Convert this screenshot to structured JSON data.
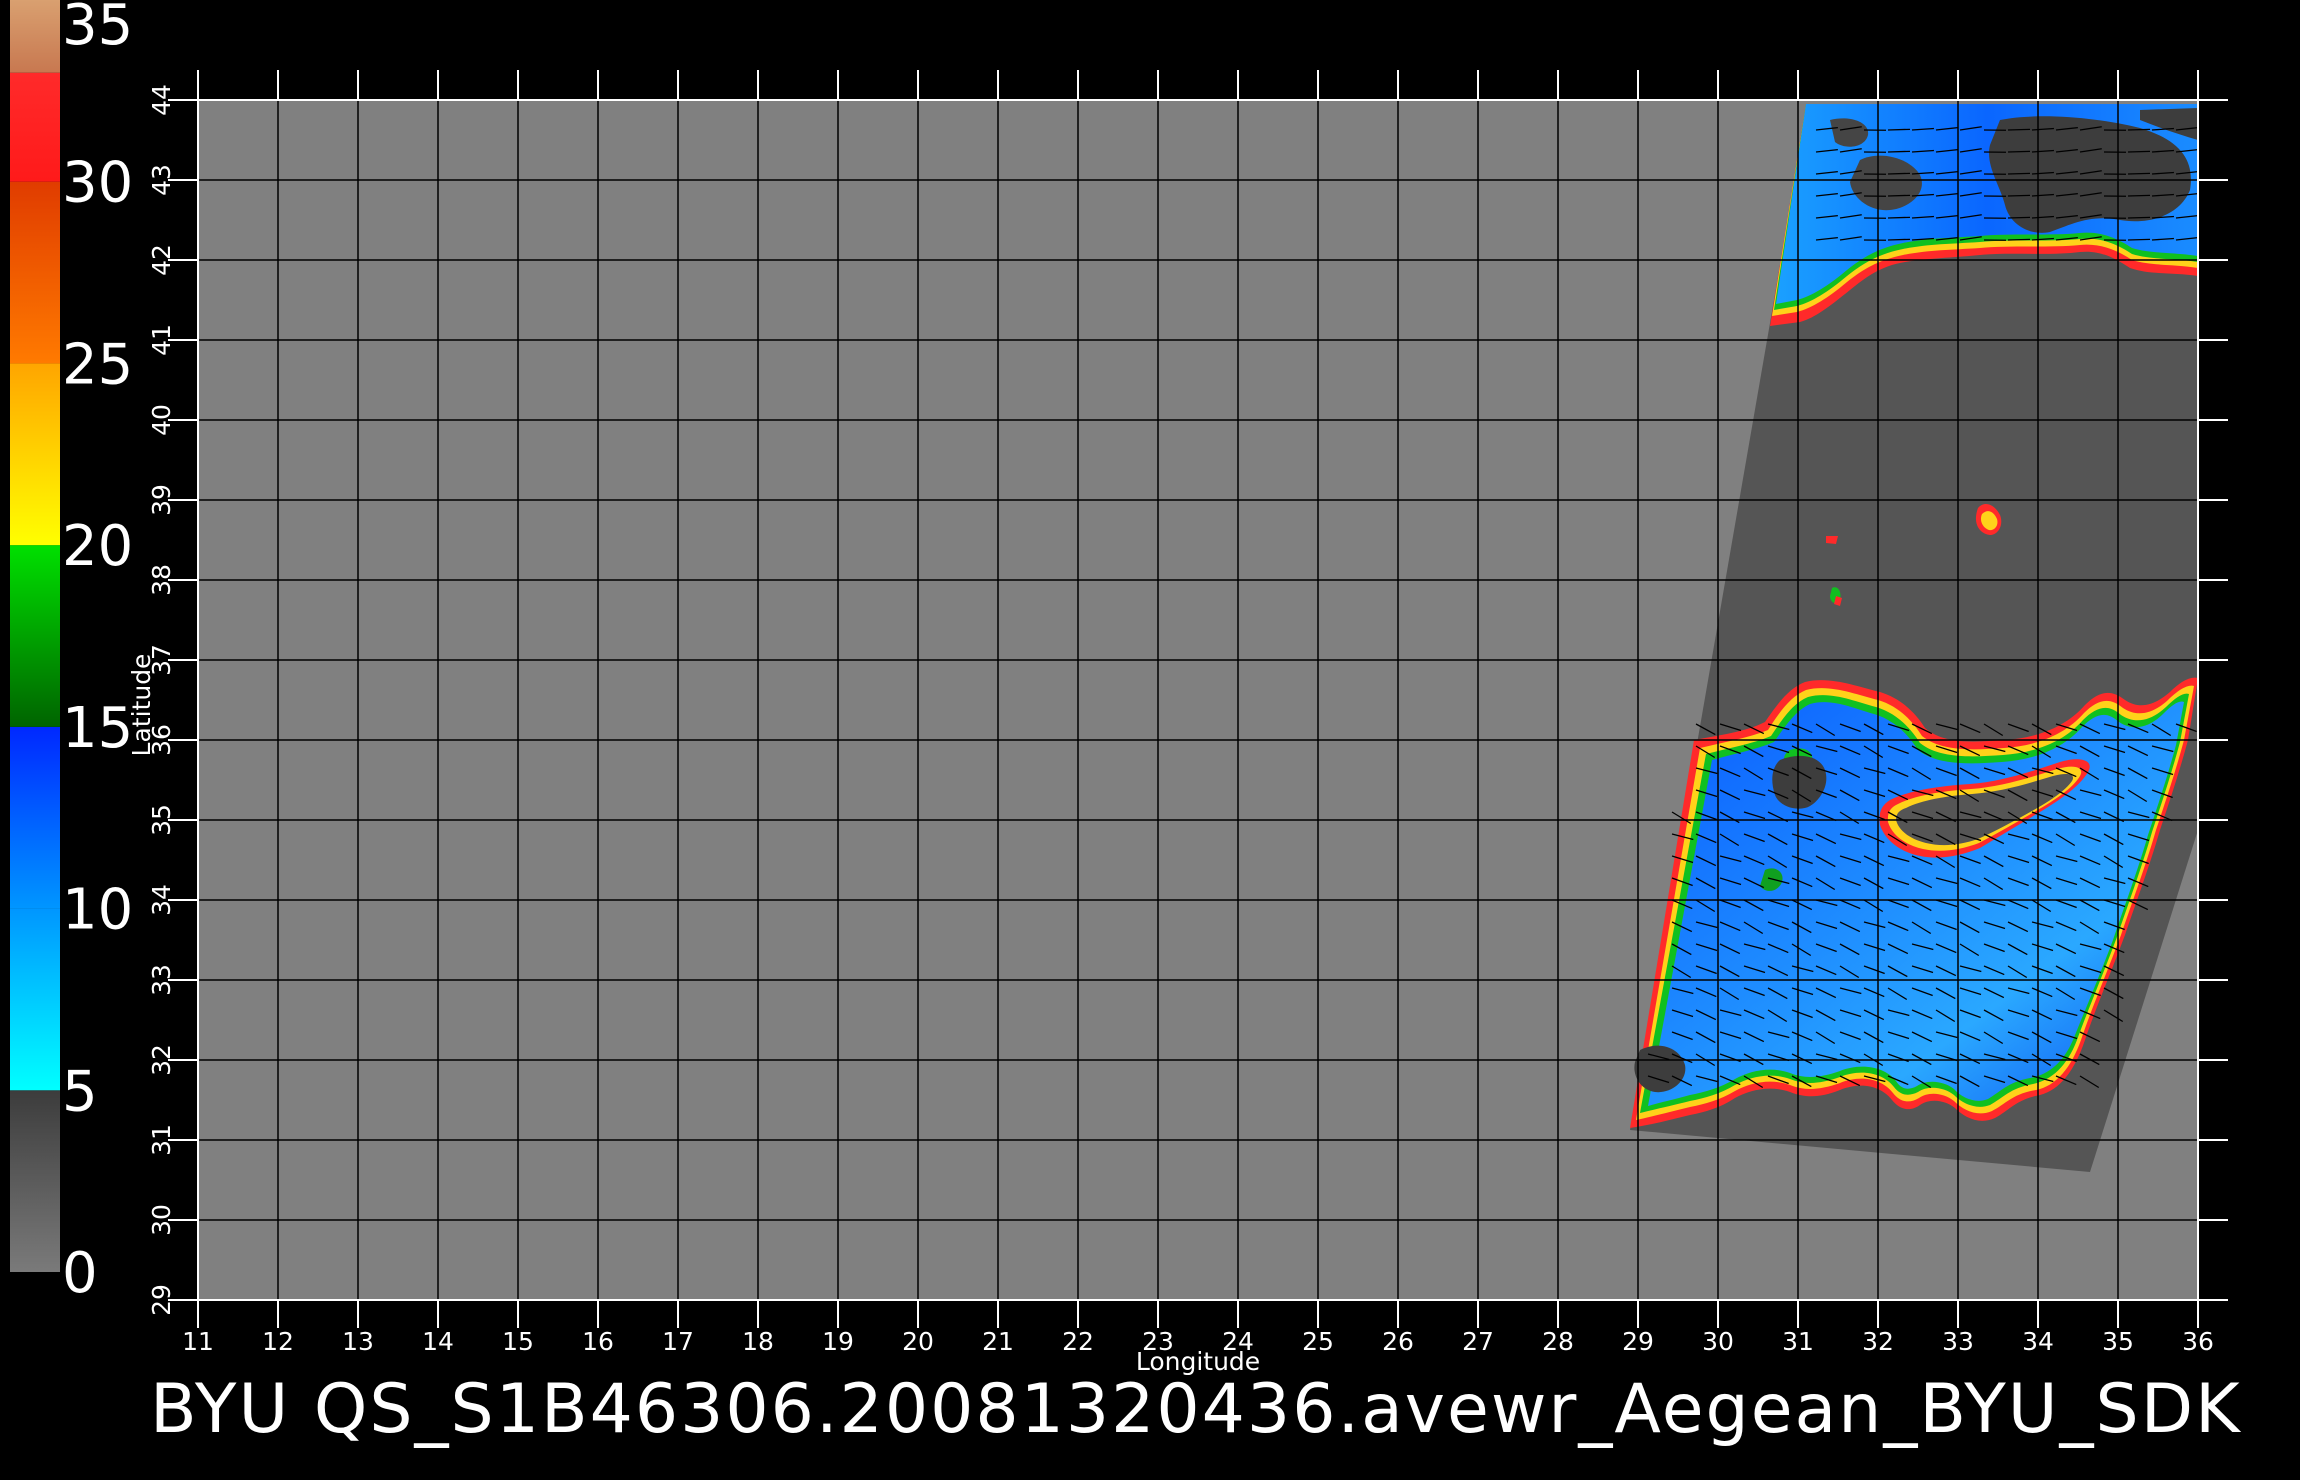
{
  "colorbar": {
    "labels": [
      "35",
      "30",
      "25",
      "20",
      "15",
      "10",
      "5",
      "0"
    ],
    "segments": [
      {
        "from": 0,
        "to": 5,
        "colors": [
          "#7a7a7a",
          "#3c3c3c"
        ]
      },
      {
        "from": 5,
        "to": 10,
        "colors": [
          "#00ffff",
          "#0096ff"
        ]
      },
      {
        "from": 10,
        "to": 15,
        "colors": [
          "#0096ff",
          "#0028ff"
        ]
      },
      {
        "from": 15,
        "to": 20,
        "colors": [
          "#006400",
          "#00e000"
        ]
      },
      {
        "from": 20,
        "to": 25,
        "colors": [
          "#ffff00",
          "#ffa500"
        ]
      },
      {
        "from": 25,
        "to": 30,
        "colors": [
          "#ff7a00",
          "#e03c00"
        ]
      },
      {
        "from": 30,
        "to": 33,
        "colors": [
          "#ff1a1a",
          "#ff2a2a"
        ]
      },
      {
        "from": 33,
        "to": 35,
        "colors": [
          "#c87850",
          "#d9a070"
        ]
      }
    ]
  },
  "map": {
    "lon_ticks": [
      "11",
      "12",
      "13",
      "14",
      "15",
      "16",
      "17",
      "18",
      "19",
      "20",
      "21",
      "22",
      "23",
      "24",
      "25",
      "26",
      "27",
      "28",
      "29",
      "30",
      "31",
      "32",
      "33",
      "34",
      "35",
      "36"
    ],
    "lat_ticks": [
      "29",
      "30",
      "31",
      "32",
      "33",
      "34",
      "35",
      "36",
      "37",
      "38",
      "39",
      "40",
      "41",
      "42",
      "43",
      "44"
    ],
    "xlabel": "Longitude",
    "ylabel": "Latitude",
    "colors": {
      "background": "#808080",
      "swath": "#555555",
      "land_blue": "#1e6cf0",
      "grid": "#000000"
    }
  },
  "footer": "BYU  QS_S1B46306.20081320436.avewr_Aegean_BYU_SDK"
}
